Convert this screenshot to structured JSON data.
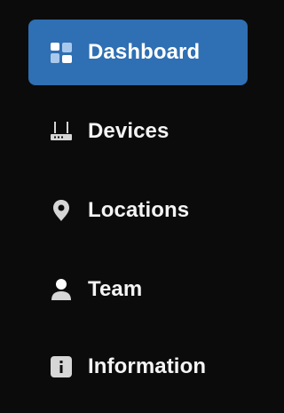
{
  "sidebar": {
    "items": [
      {
        "label": "Dashboard",
        "icon": "dashboard-icon",
        "active": true
      },
      {
        "label": "Devices",
        "icon": "router-icon",
        "active": false
      },
      {
        "label": "Locations",
        "icon": "location-pin-icon",
        "active": false
      },
      {
        "label": "Team",
        "icon": "person-icon",
        "active": false
      },
      {
        "label": "Information",
        "icon": "info-icon",
        "active": false
      }
    ]
  },
  "colors": {
    "background": "#0b0b0b",
    "active_item": "#2f6fb3",
    "icon_gray": "#cfcfcf",
    "text": "#ffffff"
  }
}
